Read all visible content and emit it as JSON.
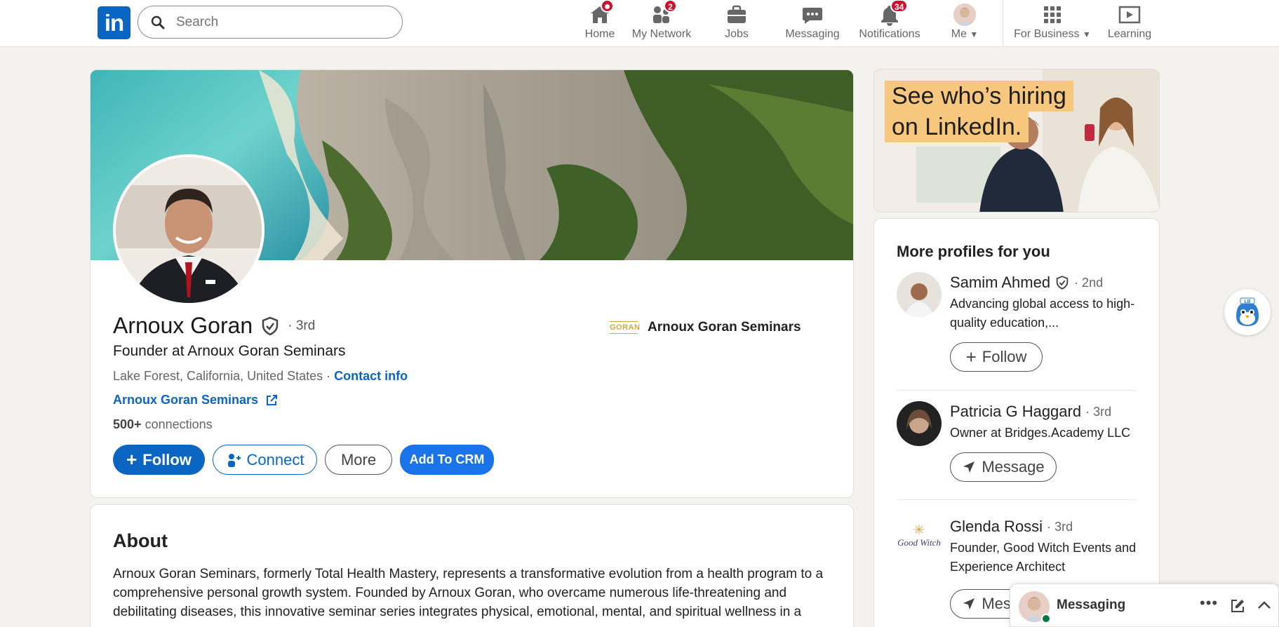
{
  "nav": {
    "logo": "in",
    "search_placeholder": "Search",
    "items": [
      {
        "label": "Home",
        "badge": ""
      },
      {
        "label": "My Network",
        "badge": "2"
      },
      {
        "label": "Jobs",
        "badge": ""
      },
      {
        "label": "Messaging",
        "badge": ""
      },
      {
        "label": "Notifications",
        "badge": "34"
      },
      {
        "label": "Me",
        "badge": ""
      },
      {
        "label": "For Business",
        "badge": ""
      },
      {
        "label": "Learning",
        "badge": ""
      }
    ],
    "colors": {
      "brand": "#0a66c2",
      "badge": "#cb112d"
    }
  },
  "profile": {
    "name": "Arnoux Goran",
    "degree": "· 3rd",
    "headline": "Founder at Arnoux Goran Seminars",
    "location": "Lake Forest, California, United States ·",
    "contact_info": "Contact info",
    "website": "Arnoux Goran Seminars",
    "connections_count": "500+",
    "connections_label": "connections",
    "company_logo_text": "GORAN",
    "company": "Arnoux Goran Seminars",
    "buttons": {
      "follow": "Follow",
      "connect": "Connect",
      "more": "More",
      "crm": "Add To CRM"
    }
  },
  "about": {
    "title": "About",
    "text": "Arnoux Goran Seminars, formerly Total Health Mastery, represents a transformative evolution from a health program to a comprehensive personal growth system. Founded by Arnoux Goran, who overcame numerous life-threatening and debilitating diseases, this innovative seminar series integrates physical, emotional, mental, and spiritual wellness in a"
  },
  "ad": {
    "line1": "See who’s hiring",
    "line2": "on LinkedIn."
  },
  "more_profiles": {
    "title": "More profiles for you",
    "people": [
      {
        "name": "Samim Ahmed",
        "degree": "· 2nd",
        "desc": "Advancing global access to high-quality education,...",
        "action": "Follow"
      },
      {
        "name": "Patricia G Haggard",
        "degree": "· 3rd",
        "desc": "Owner at Bridges.Academy LLC",
        "action": "Message"
      },
      {
        "name": "Glenda Rossi",
        "degree": "· 3rd",
        "desc": "Founder, Good Witch Events and Experience Architect",
        "action": "Message"
      }
    ]
  },
  "floating": {
    "lb_label": "LB"
  },
  "messaging": {
    "label": "Messaging"
  }
}
